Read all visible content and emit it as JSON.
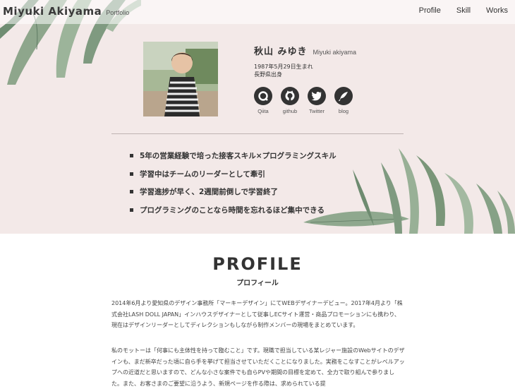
{
  "header": {
    "brand_name": "Miyuki Akiyama",
    "brand_sub": "Portfolio",
    "nav": [
      "Profile",
      "Skill",
      "Works"
    ]
  },
  "profile": {
    "name_ja": "秋山 みゆき",
    "name_en": "Miyuki akiyama",
    "birth": "1987年5月29日生まれ",
    "origin": "長野県出身",
    "social": [
      {
        "label": "Qiita",
        "icon": "qiita-icon"
      },
      {
        "label": "github",
        "icon": "github-icon"
      },
      {
        "label": "Twitter",
        "icon": "twitter-icon"
      },
      {
        "label": "blog",
        "icon": "quill-icon"
      }
    ],
    "highlights": [
      "5年の営業経験で培った接客スキル×プログラミングスキル",
      "学習中はチームのリーダーとして牽引",
      "学習進捗が早く、2週間前倒しで学習終了",
      "プログラミングのことなら時間を忘れるほど集中できる"
    ]
  },
  "section": {
    "title": "PROFILE",
    "subtitle": "プロフィール",
    "paragraph1": "2014年6月より愛知県のデザイン事務所「マーキーデザイン」にてWEBデザイナーデビュー。2017年4月より「株式会社LASH DOLL JAPAN」インハウスデザイナーとして従事しECサイト運営・商品プロモーションにも携わり、現在はデザインリーダーとしてディレクションもしながら制作メンバーの現場をまとめています。",
    "paragraph2": "私のモットーは「何事にも主体性を持って臨むこと」です。現職で担当している某レジャー施設のWebサイトのデザインも、まだ新卒だった頃に自ら手を挙げて担当させていただくことになりました。実務をこなすことがレベルアップへの近道だと思いますので、どんな小さな案件でも自らPVや期間の目標を定めて、全力で取り組んで参りました。また、お客さまのご要望に沿うよう、新規ページを作る際は、求められている提"
  },
  "colors": {
    "hero_bg": "#f3e9e8",
    "leaf": "#7d9a82",
    "text": "#333333"
  }
}
